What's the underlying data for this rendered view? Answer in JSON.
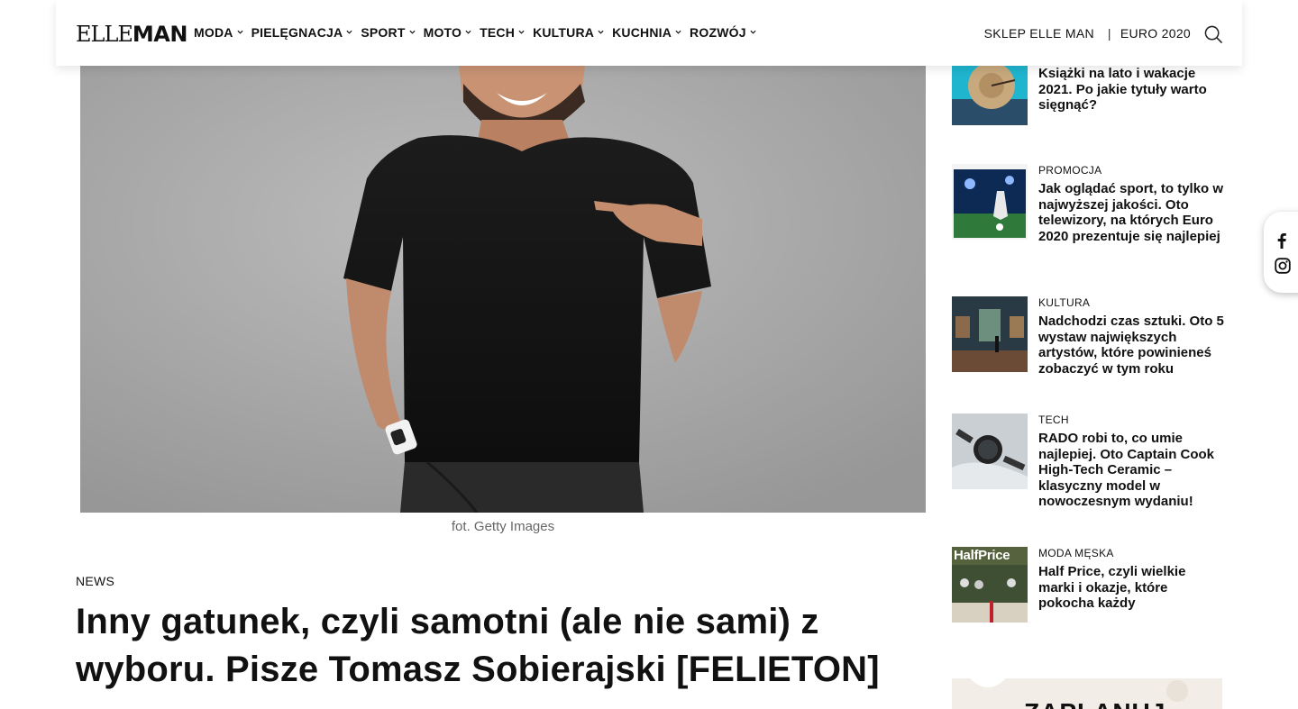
{
  "header": {
    "logo_elle": "ELLE",
    "logo_man": "MAN",
    "nav": [
      {
        "label": "MODA"
      },
      {
        "label": "PIELĘGNACJA"
      },
      {
        "label": "SPORT"
      },
      {
        "label": "MOTO"
      },
      {
        "label": "TECH"
      },
      {
        "label": "KULTURA"
      },
      {
        "label": "KUCHNIA"
      },
      {
        "label": "ROZWÓJ"
      }
    ],
    "shop_link": "SKLEP ELLE MAN",
    "separator": "|",
    "euro_link": "EURO 2020",
    "search_icon": "search-icon"
  },
  "article": {
    "caption": "fot. Getty Images",
    "category": "NEWS",
    "title": "Inny gatunek, czyli samotni (ale nie sami) z wyboru. Pisze Tomasz Sobierajski [FELIETON]"
  },
  "sidebar": {
    "items": [
      {
        "category": "",
        "title": "Książki na lato i wakacje 2021. Po jakie tytuły warto sięgnąć?"
      },
      {
        "category": "PROMOCJA",
        "title": "Jak oglądać sport, to tylko w najwyższej jakości. Oto telewizory, na których Euro 2020 prezentuje się najlepiej"
      },
      {
        "category": "KULTURA",
        "title": "Nadchodzi czas sztuki. Oto 5 wystaw największych artystów, które powinieneś zobaczyć w tym roku"
      },
      {
        "category": "TECH",
        "title": "RADO robi to, co umie najlepiej. Oto Captain Cook High-Tech Ceramic – klasyczny model w nowoczesnym wydaniu!"
      },
      {
        "category": "MODA MĘSKA",
        "title": "Half Price, czyli wielkie marki i okazje, które pokocha każdy",
        "thumb_text": "HalfPrice"
      }
    ],
    "ad_text": "ZAPLANUJ"
  },
  "social": {
    "facebook_icon": "facebook-icon",
    "instagram_icon": "instagram-icon"
  }
}
